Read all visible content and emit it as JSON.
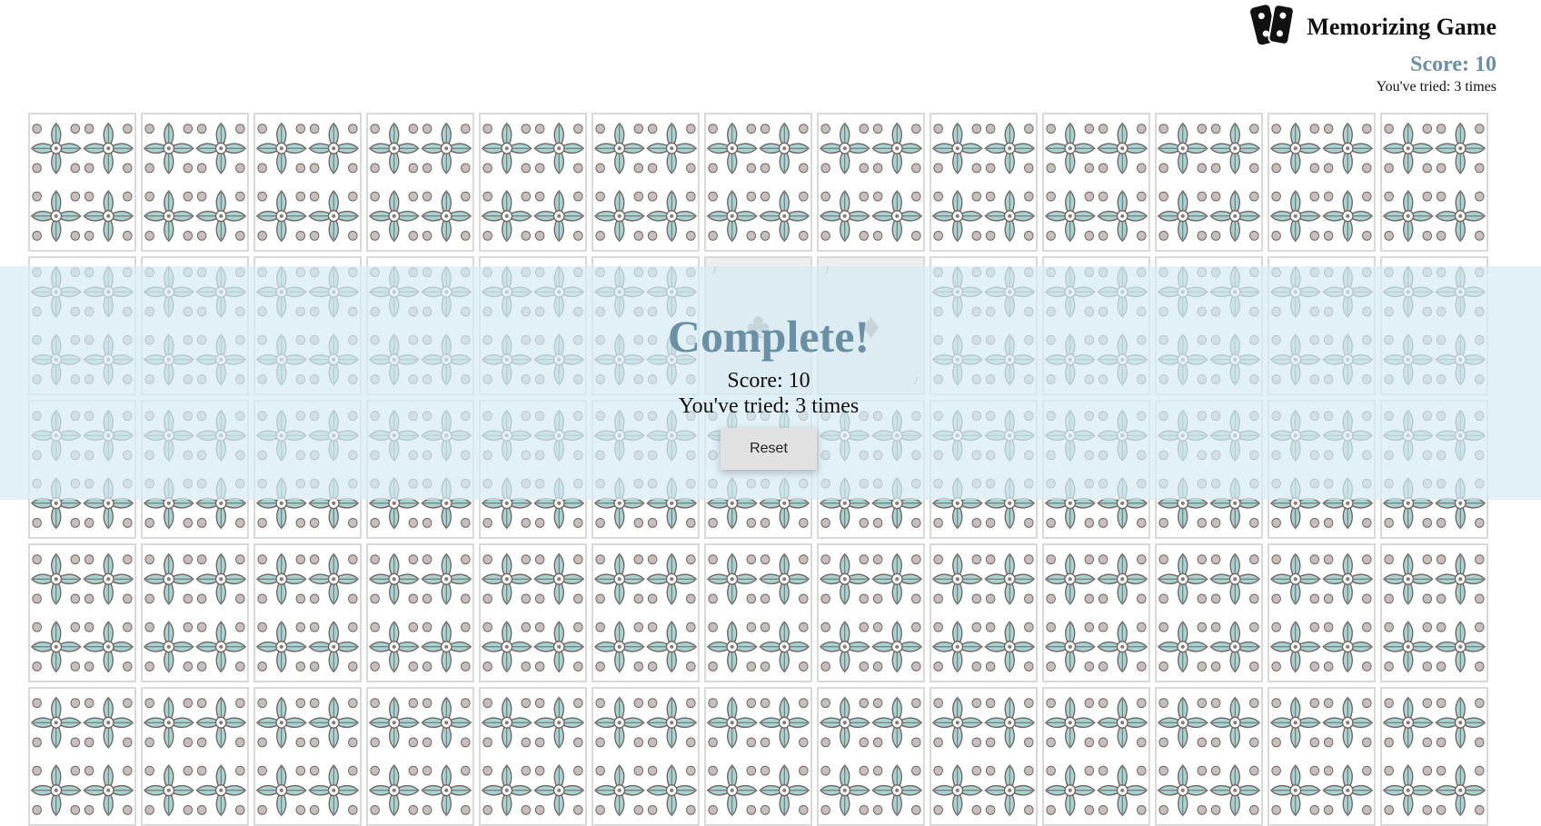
{
  "header": {
    "title": "Memorizing Game",
    "logo_icon": "playing-cards-icon",
    "score_text": "Score: 10",
    "tries_text": "You've tried: 3 times"
  },
  "board": {
    "columns": 13,
    "rows": 5,
    "card_back_colors": {
      "leaf": "#a9d3d0",
      "outline": "#6e6462",
      "bg": "#ffffff"
    },
    "revealed_cards": [
      {
        "row": 1,
        "col": 6,
        "rank": "J",
        "suit": "♣"
      },
      {
        "row": 1,
        "col": 7,
        "rank": "J",
        "suit": "♦"
      }
    ]
  },
  "complete_dialog": {
    "title": "Complete!",
    "score_text": "Score: 10",
    "tries_text": "You've tried: 3 times",
    "reset_label": "Reset"
  },
  "colors": {
    "accent": "#6b8fa3",
    "overlay": "#d7ebf4"
  }
}
